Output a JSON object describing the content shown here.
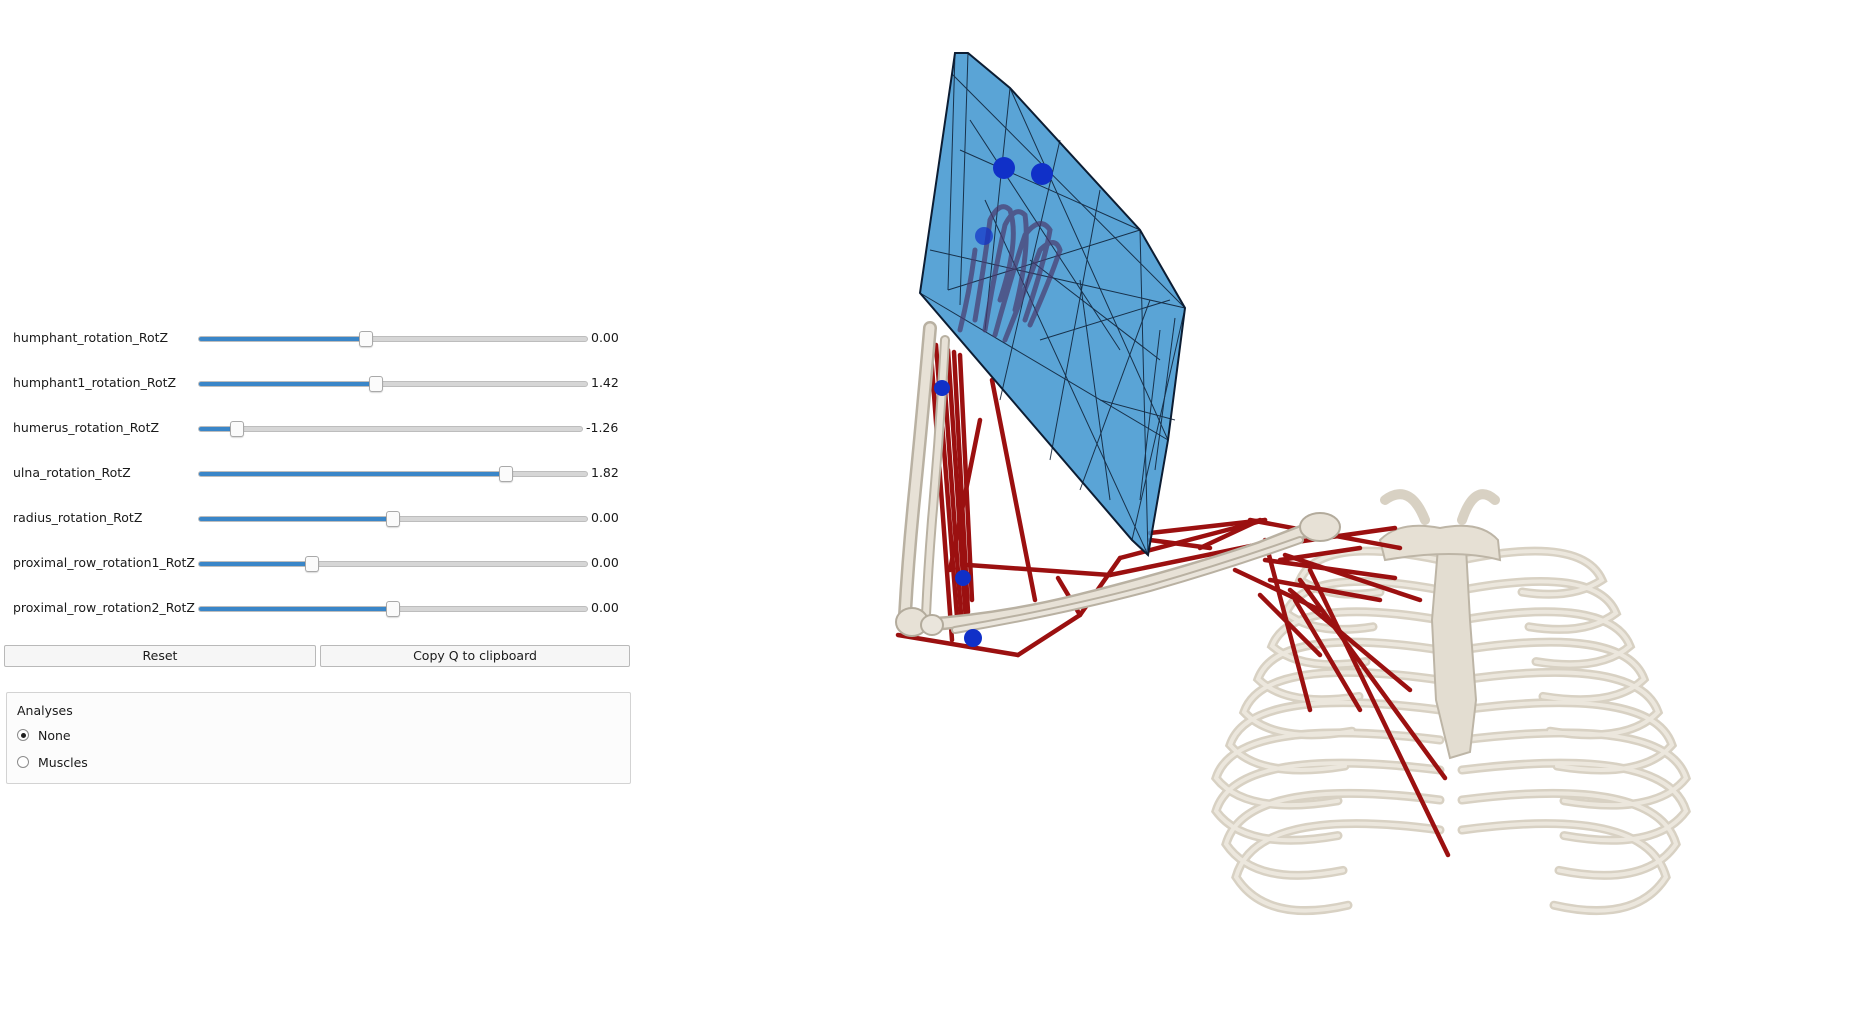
{
  "sliders": [
    {
      "label": "humphant_rotation_RotZ",
      "value": "0.00",
      "fraction": 0.43
    },
    {
      "label": "humphant1_rotation_RotZ",
      "value": "1.42",
      "fraction": 0.455
    },
    {
      "label": "humerus_rotation_RotZ",
      "value": "-1.26",
      "fraction": 0.1
    },
    {
      "label": "ulna_rotation_RotZ",
      "value": "1.82",
      "fraction": 0.79
    },
    {
      "label": "radius_rotation_RotZ",
      "value": "0.00",
      "fraction": 0.5
    },
    {
      "label": "proximal_row_rotation1_RotZ",
      "value": "0.00",
      "fraction": 0.29
    },
    {
      "label": "proximal_row_rotation2_RotZ",
      "value": "0.00",
      "fraction": 0.5
    }
  ],
  "buttons": {
    "reset": "Reset",
    "copy_q": "Copy Q to clipboard"
  },
  "analyses": {
    "title": "Analyses",
    "options": [
      {
        "label": "None",
        "checked": true
      },
      {
        "label": "Muscles",
        "checked": false
      }
    ]
  },
  "colors": {
    "accent": "#3a86c8",
    "muscle": "#9b1010",
    "bone": "#e7e1d6",
    "hand_mesh": "#3f95cf",
    "marker": "#1030c8"
  },
  "viewport": {
    "content": "3D musculoskeletal model: thorax, humerus, ulna, radius, hand mesh, muscles, markers"
  }
}
